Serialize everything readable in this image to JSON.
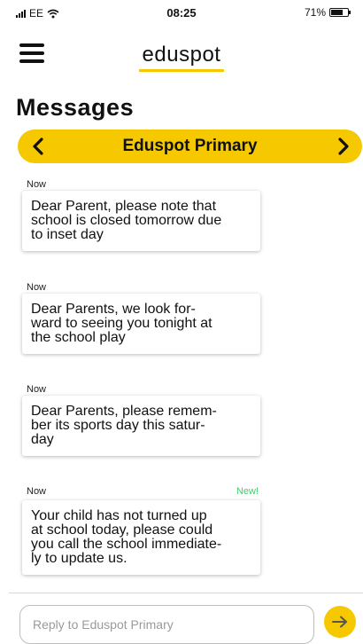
{
  "status_bar": {
    "carrier": "EE",
    "time": "08:25",
    "battery": "71%",
    "battery_level": 0.71
  },
  "header": {
    "logo": "eduspot",
    "menu_icon": "hamburger-menu-icon"
  },
  "page": {
    "title": "Messages"
  },
  "selector": {
    "prev_icon": "chevron-left-icon",
    "school": "Eduspot Primary",
    "next_icon": "chevron-right-icon"
  },
  "messages": [
    {
      "time": "Now",
      "new_label": "",
      "lines": [
        "Dear Parent, please note that",
        "school is closed tomorrow due",
        "to inset day"
      ]
    },
    {
      "time": "Now",
      "new_label": "",
      "lines": [
        "Dear Parents, we look for-",
        "ward to seeing you tonight at",
        "the school play"
      ]
    },
    {
      "time": "Now",
      "new_label": "",
      "lines": [
        "Dear Parents, please remem-",
        "ber its sports day this satur-",
        "day"
      ]
    },
    {
      "time": "Now",
      "new_label": "New!",
      "lines": [
        "Your child has not turned up",
        "at school today, please could",
        "you call the school immediate-",
        "ly to update us."
      ]
    }
  ],
  "reply": {
    "placeholder": "Reply to Eduspot Primary",
    "value": "",
    "send_icon": "arrow-right-icon"
  },
  "colors": {
    "accent": "#f5c800",
    "new_badge": "#3ecf6b"
  }
}
